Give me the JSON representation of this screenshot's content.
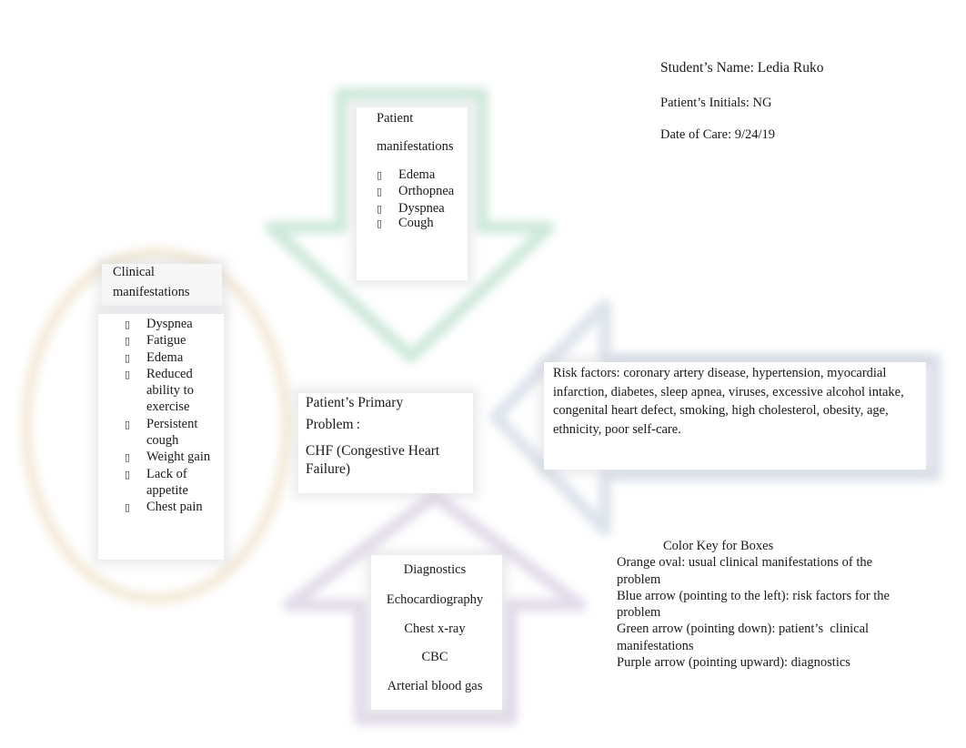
{
  "header": {
    "student_name": "Student’s Name: Ledia Ruko",
    "patient_initials": "Patient’s Initials: NG",
    "date_of_care": "Date of Care: 9/24/19"
  },
  "colors": {
    "green_arrow": "#cfe9dc",
    "blue_arrow": "#dde4ec",
    "purple_arrow": "#e2dcea",
    "orange_oval": "#f3ead8"
  },
  "patient_manifestations": {
    "title_line1": "Patient",
    "title_line2": "manifestations",
    "bullet_icon": "square-bullet-icon",
    "items": [
      "Edema",
      "Orthopnea",
      "Dyspnea",
      "Cough"
    ]
  },
  "clinical_manifestations": {
    "title_line1": "Clinical",
    "title_line2": "manifestations",
    "items": [
      "Dyspnea",
      "Fatigue",
      "Edema",
      "Reduced ability to exercise",
      "Persistent cough",
      "Weight gain",
      "Lack of appetite",
      "Chest pain"
    ]
  },
  "primary_problem": {
    "label_line1": "Patient’s Primary",
    "label_line2": "Problem :",
    "value": "CHF (Congestive Heart Failure)"
  },
  "risk_factors": {
    "text": "Risk factors: coronary artery disease, hypertension, myocardial infarction, diabetes, sleep apnea, viruses, excessive alcohol intake, congenital heart defect, smoking, high cholesterol, obesity, age, ethnicity, poor self-care."
  },
  "diagnostics": {
    "title": "Diagnostics",
    "items": [
      "Echocardiography",
      "Chest x-ray",
      "CBC",
      "Arterial blood gas"
    ]
  },
  "color_key": {
    "title": "Color Key for Boxes",
    "entries": [
      "Orange oval: usual clinical manifestations of the problem",
      "Blue arrow (pointing to the left): risk factors for the problem",
      "Green arrow (pointing down): patient’s  clinical manifestations",
      "Purple arrow (pointing upward): diagnostics"
    ]
  }
}
